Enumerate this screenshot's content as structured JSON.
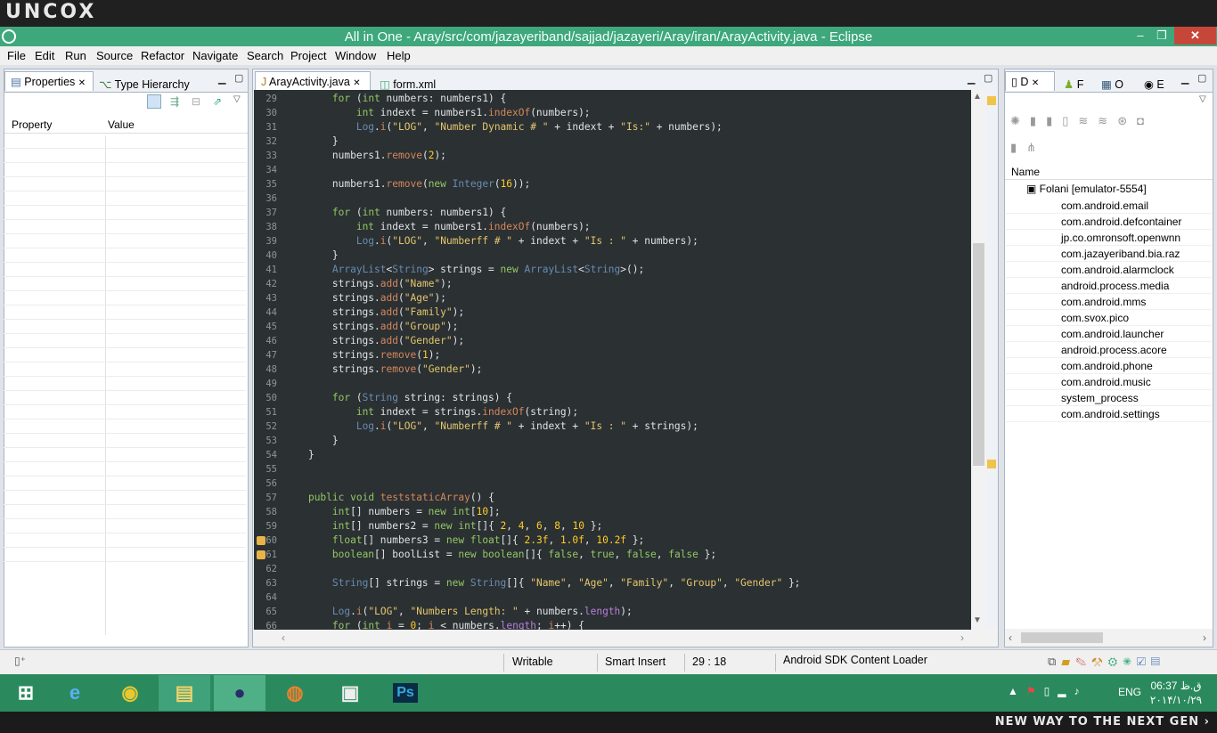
{
  "brand": {
    "top_logo": "UNCOX",
    "bottom_tagline": "NEW WAY TO THE NEXT GEN ›"
  },
  "window": {
    "title": "All in One - Aray/src/com/jazayeriband/sajjad/jazayeri/Aray/iran/ArayActivity.java - Eclipse",
    "minimize": "–",
    "restore": "❐",
    "close": "✕"
  },
  "menu": [
    "File",
    "Edit",
    "Run",
    "Source",
    "Refactor",
    "Navigate",
    "Search",
    "Project",
    "Window",
    "Help"
  ],
  "left_panel": {
    "tabs": [
      "Properties",
      "Type Hierarchy"
    ],
    "columns": [
      "Property",
      "Value"
    ]
  },
  "editor": {
    "tabs": [
      "ArayActivity.java",
      "form.xml"
    ],
    "lines": [
      {
        "n": "29",
        "t": "        for (int numbers: numbers1) {"
      },
      {
        "n": "30",
        "t": "            int indext = numbers1.indexOf(numbers);"
      },
      {
        "n": "31",
        "t": "            Log.i(\"LOG\", \"Number Dynamic # \" + indext + \"Is:\" + numbers);"
      },
      {
        "n": "32",
        "t": "        }"
      },
      {
        "n": "33",
        "t": "        numbers1.remove(2);"
      },
      {
        "n": "34",
        "t": ""
      },
      {
        "n": "35",
        "t": "        numbers1.remove(new Integer(16));"
      },
      {
        "n": "36",
        "t": ""
      },
      {
        "n": "37",
        "t": "        for (int numbers: numbers1) {"
      },
      {
        "n": "38",
        "t": "            int indext = numbers1.indexOf(numbers);"
      },
      {
        "n": "39",
        "t": "            Log.i(\"LOG\", \"Numberff # \" + indext + \"Is : \" + numbers);"
      },
      {
        "n": "40",
        "t": "        }"
      },
      {
        "n": "41",
        "t": "        ArrayList<String> strings = new ArrayList<String>();"
      },
      {
        "n": "42",
        "t": "        strings.add(\"Name\");"
      },
      {
        "n": "43",
        "t": "        strings.add(\"Age\");"
      },
      {
        "n": "44",
        "t": "        strings.add(\"Family\");"
      },
      {
        "n": "45",
        "t": "        strings.add(\"Group\");"
      },
      {
        "n": "46",
        "t": "        strings.add(\"Gender\");"
      },
      {
        "n": "47",
        "t": "        strings.remove(1);"
      },
      {
        "n": "48",
        "t": "        strings.remove(\"Gender\");"
      },
      {
        "n": "49",
        "t": ""
      },
      {
        "n": "50",
        "t": "        for (String string: strings) {"
      },
      {
        "n": "51",
        "t": "            int indext = strings.indexOf(string);"
      },
      {
        "n": "52",
        "t": "            Log.i(\"LOG\", \"Numberff # \" + indext + \"Is : \" + strings);"
      },
      {
        "n": "53",
        "t": "        }"
      },
      {
        "n": "54",
        "t": "    }"
      },
      {
        "n": "55",
        "t": ""
      },
      {
        "n": "56",
        "t": ""
      },
      {
        "n": "57",
        "t": "    public void teststaticArray() {"
      },
      {
        "n": "58",
        "t": "        int[] numbers = new int[10];"
      },
      {
        "n": "59",
        "t": "        int[] numbers2 = new int[]{ 2, 4, 6, 8, 10 };"
      },
      {
        "n": "60",
        "t": "        float[] numbers3 = new float[]{ 2.3f, 1.0f, 10.2f };"
      },
      {
        "n": "61",
        "t": "        boolean[] boolList = new boolean[]{ false, true, false, false };"
      },
      {
        "n": "62",
        "t": ""
      },
      {
        "n": "63",
        "t": "        String[] strings = new String[]{ \"Name\", \"Age\", \"Family\", \"Group\", \"Gender\" };"
      },
      {
        "n": "64",
        "t": ""
      },
      {
        "n": "65",
        "t": "        Log.i(\"LOG\", \"Numbers Length: \" + numbers.length);"
      },
      {
        "n": "66",
        "t": "        for (int i = 0; i < numbers.length; i++) {"
      }
    ]
  },
  "right_panel": {
    "tabs": [
      "D",
      "F",
      "O",
      "E"
    ],
    "column": "Name",
    "device": "Folani [emulator-5554]",
    "processes": [
      "com.android.email",
      "com.android.defcontainer",
      "jp.co.omronsoft.openwnn",
      "com.jazayeriband.bia.raz",
      "com.android.alarmclock",
      "android.process.media",
      "com.android.mms",
      "com.svox.pico",
      "com.android.launcher",
      "android.process.acore",
      "com.android.phone",
      "com.android.music",
      "system_process",
      "com.android.settings"
    ]
  },
  "status": {
    "writable": "Writable",
    "insert": "Smart Insert",
    "position": "29 : 18",
    "task": "Android SDK Content Loader"
  },
  "taskbar": {
    "lang": "ENG",
    "time": "06:37 ق.ظ",
    "date": "۲۰۱۴/۱۰/۲۹",
    "apps": [
      "Internet Explorer",
      "Chrome",
      "File Explorer",
      "Eclipse",
      "Firefox",
      "Notepad",
      "Photoshop"
    ]
  },
  "colors": {
    "title": "#3ea77c",
    "taskbar": "#2a8a5e",
    "editor_bg": "#2b3033"
  }
}
